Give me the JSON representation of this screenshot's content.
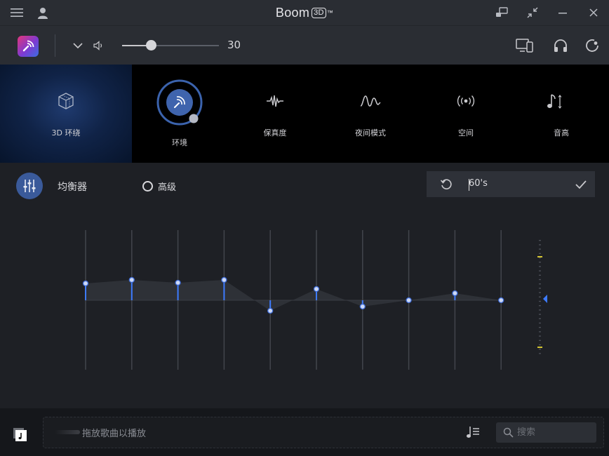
{
  "window": {
    "title": "Boom",
    "title_badge": "3D",
    "title_tm": "™"
  },
  "toolbar": {
    "volume": 30,
    "volume_label": "30"
  },
  "effects": [
    {
      "id": "3d-surround",
      "label": "3D 环绕",
      "active": true
    },
    {
      "id": "ambience",
      "label": "环境"
    },
    {
      "id": "fidelity",
      "label": "保真度"
    },
    {
      "id": "night-mode",
      "label": "夜间模式"
    },
    {
      "id": "spatial",
      "label": "空间"
    },
    {
      "id": "pitch",
      "label": "音高"
    }
  ],
  "equalizer": {
    "title": "均衡器",
    "advanced_label": "高级",
    "advanced_checked": false,
    "preset": "60's",
    "bands": [
      0.24,
      0.29,
      0.25,
      0.29,
      -0.15,
      0.16,
      -0.09,
      0.0,
      0.1,
      0.0
    ]
  },
  "colors": {
    "accent": "#3d7bff",
    "preset_mark": "#d4c431",
    "pointer": "#3d7bff"
  },
  "player": {
    "drop_hint": "拖放歌曲以播放",
    "search_placeholder": "搜索"
  }
}
